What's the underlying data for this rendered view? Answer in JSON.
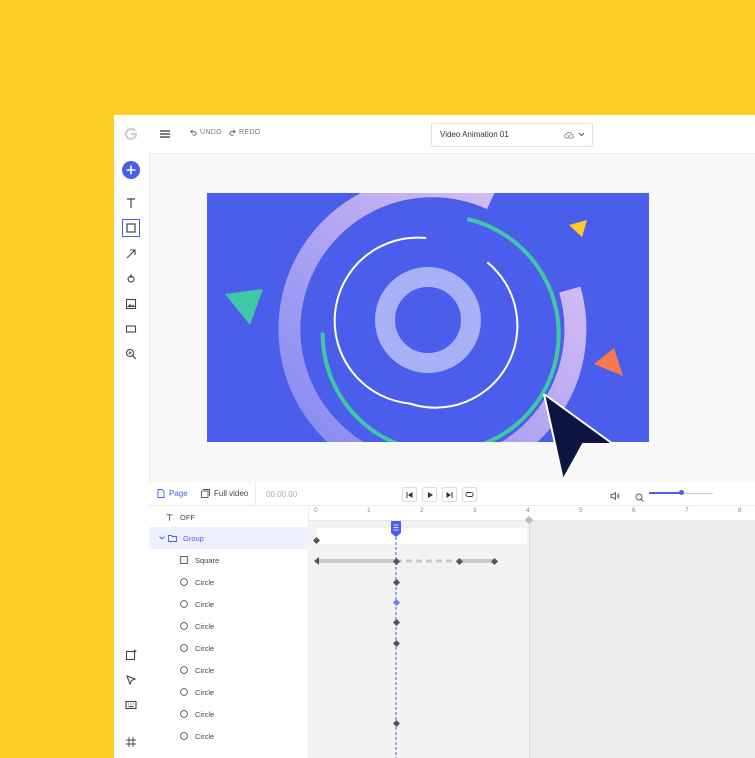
{
  "toolbar": {
    "undo_label": "UNDO",
    "redo_label": "REDO",
    "project_title": "Video Animation 01"
  },
  "timeline": {
    "tab_page": "Page",
    "tab_full_video": "Full video",
    "current_time": "00:00.00",
    "zoom_level": 0.5,
    "ruler_ticks": [
      "0",
      "1",
      "2",
      "3",
      "4",
      "5",
      "6",
      "7",
      "8"
    ],
    "layers": {
      "off_label": "OFF",
      "group_label": "Group",
      "items": [
        "Square",
        "Circle",
        "Circle",
        "Circle",
        "Circle",
        "Circle",
        "Circle",
        "Circle",
        "Circle"
      ]
    }
  },
  "colors": {
    "background": "#FFCE26",
    "accent": "#4A5EEB",
    "canvas": "#4A5EEB",
    "teal": "#3FC7A6",
    "orange": "#F47A4F",
    "yellow": "#FFCE26",
    "cursor": "#0C1640"
  }
}
